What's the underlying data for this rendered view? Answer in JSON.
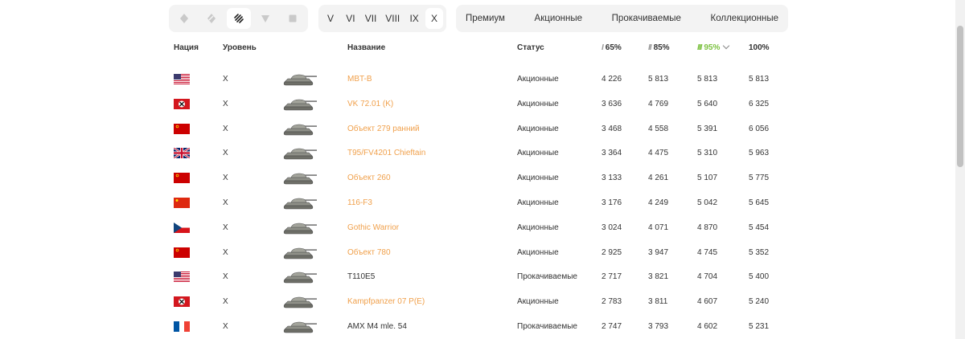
{
  "filters": {
    "types": [
      {
        "icon": "light-tank-icon",
        "active": false
      },
      {
        "icon": "medium-tank-icon",
        "active": false
      },
      {
        "icon": "heavy-tank-icon",
        "active": true
      },
      {
        "icon": "tank-destroyer-icon",
        "active": false
      },
      {
        "icon": "spg-icon",
        "active": false
      }
    ],
    "tiers": [
      "V",
      "VI",
      "VII",
      "VIII",
      "IX",
      "X"
    ],
    "active_tier": "X",
    "statuses": [
      "Премиум",
      "Акционные",
      "Прокачиваемые",
      "Коллекционные"
    ]
  },
  "table": {
    "headers": {
      "nation": "Нация",
      "tier": "Уровень",
      "name": "Название",
      "status": "Статус",
      "p65_mark": "I",
      "p65": "65%",
      "p85_mark": "II",
      "p85": "85%",
      "p95_mark": "III",
      "p95": "95%",
      "p100": "100%"
    },
    "rows": [
      {
        "flag": "usa",
        "tier": "X",
        "name": "MBT-B",
        "name_color": "orange",
        "status": "Акционные",
        "p65": "4 226",
        "p85": "5 813",
        "p95": "5 813",
        "p100": "5 813"
      },
      {
        "flag": "germany",
        "tier": "X",
        "name": "VK 72.01 (K)",
        "name_color": "orange",
        "status": "Акционные",
        "p65": "3 636",
        "p85": "4 769",
        "p95": "5 640",
        "p100": "6 325"
      },
      {
        "flag": "ussr",
        "tier": "X",
        "name": "Объект 279 ранний",
        "name_color": "orange",
        "status": "Акционные",
        "p65": "3 468",
        "p85": "4 558",
        "p95": "5 391",
        "p100": "6 056"
      },
      {
        "flag": "uk",
        "tier": "X",
        "name": "T95/FV4201 Chieftain",
        "name_color": "orange",
        "status": "Акционные",
        "p65": "3 364",
        "p85": "4 475",
        "p95": "5 310",
        "p100": "5 963"
      },
      {
        "flag": "ussr",
        "tier": "X",
        "name": "Объект 260",
        "name_color": "orange",
        "status": "Акционные",
        "p65": "3 133",
        "p85": "4 261",
        "p95": "5 107",
        "p100": "5 775"
      },
      {
        "flag": "china",
        "tier": "X",
        "name": "116-F3",
        "name_color": "orange",
        "status": "Акционные",
        "p65": "3 176",
        "p85": "4 249",
        "p95": "5 042",
        "p100": "5 645"
      },
      {
        "flag": "czech",
        "tier": "X",
        "name": "Gothic Warrior",
        "name_color": "orange",
        "status": "Акционные",
        "p65": "3 024",
        "p85": "4 071",
        "p95": "4 870",
        "p100": "5 454"
      },
      {
        "flag": "ussr",
        "tier": "X",
        "name": "Объект 780",
        "name_color": "orange",
        "status": "Акционные",
        "p65": "2 925",
        "p85": "3 947",
        "p95": "4 745",
        "p100": "5 352"
      },
      {
        "flag": "usa",
        "tier": "X",
        "name": "T110E5",
        "name_color": "dark",
        "status": "Прокачиваемые",
        "p65": "2 717",
        "p85": "3 821",
        "p95": "4 704",
        "p100": "5 400"
      },
      {
        "flag": "germany",
        "tier": "X",
        "name": "Kampfpanzer 07 P(E)",
        "name_color": "orange",
        "status": "Акционные",
        "p65": "2 783",
        "p85": "3 811",
        "p95": "4 607",
        "p100": "5 240"
      },
      {
        "flag": "france",
        "tier": "X",
        "name": "AMX M4 mle. 54",
        "name_color": "dark",
        "status": "Прокачиваемые",
        "p65": "2 747",
        "p85": "3 793",
        "p95": "4 602",
        "p100": "5 231"
      }
    ]
  },
  "colors": {
    "accent_orange": "#f0a04b",
    "accent_green": "#7dc242",
    "panel_bg": "#f3f3f3"
  }
}
